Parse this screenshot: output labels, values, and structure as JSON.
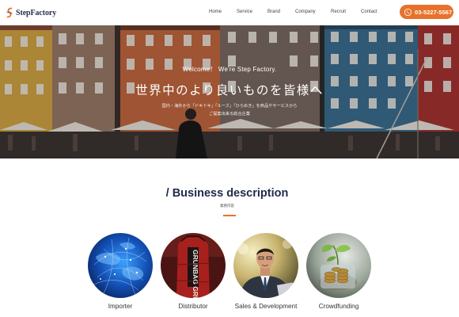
{
  "header": {
    "logo_text": "StepFactory",
    "nav": [
      {
        "label": "Home",
        "name": "nav-home"
      },
      {
        "label": "Service",
        "name": "nav-service"
      },
      {
        "label": "Brand",
        "name": "nav-brand"
      },
      {
        "label": "Company",
        "name": "nav-company"
      },
      {
        "label": "Recruit",
        "name": "nav-recruit"
      },
      {
        "label": "Contact",
        "name": "nav-contact"
      }
    ],
    "phone": "03-5227-5567",
    "phone_icon": "phone-icon"
  },
  "hero": {
    "welcome": "Welcome！ We're Step Factory.",
    "title": "世界中のより良いものを皆様へ",
    "sub_line1": "国内・海外から「ドキドキ」「ルーズ」「ひらめき」を商品やサービスから",
    "sub_line2": "ご提案出来る総合企業"
  },
  "business": {
    "title": "/ Business description",
    "subtitle": "業務内容",
    "items": [
      {
        "label": "Importer",
        "image": "globe-network-image"
      },
      {
        "label": "Distributor",
        "image": "grunbag-bag-image"
      },
      {
        "label": "Sales & Development",
        "image": "businessman-image"
      },
      {
        "label": "Crowdfunding",
        "image": "coins-plant-image"
      }
    ],
    "bag_text": "GRUNBAG GRU"
  },
  "colors": {
    "accent": "#e8722c",
    "heading": "#1f2a4a"
  }
}
